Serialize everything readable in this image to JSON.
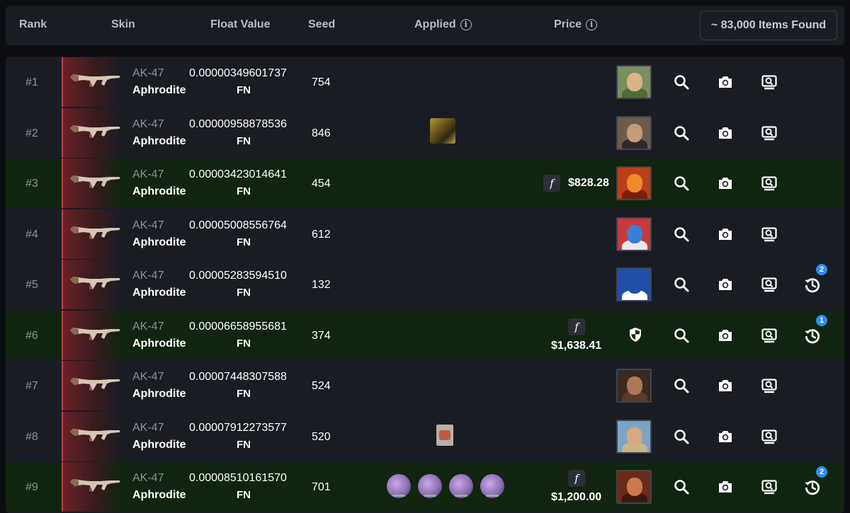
{
  "header": {
    "rank": "Rank",
    "skin": "Skin",
    "float_value": "Float Value",
    "seed": "Seed",
    "applied": "Applied",
    "price": "Price",
    "info_glyph": "i",
    "items_found": "~ 83,000 Items Found"
  },
  "rows": [
    {
      "rank": "#1",
      "weapon": "AK-47",
      "skin": "Aphrodite",
      "float": "0.00000349601737",
      "wear": "FN",
      "seed": "754",
      "price": "",
      "history": ""
    },
    {
      "rank": "#2",
      "weapon": "AK-47",
      "skin": "Aphrodite",
      "float": "0.00000958878536",
      "wear": "FN",
      "seed": "846",
      "price": "",
      "history": ""
    },
    {
      "rank": "#3",
      "weapon": "AK-47",
      "skin": "Aphrodite",
      "float": "0.00003423014641",
      "wear": "FN",
      "seed": "454",
      "price": "$828.28",
      "history": ""
    },
    {
      "rank": "#4",
      "weapon": "AK-47",
      "skin": "Aphrodite",
      "float": "0.00005008556764",
      "wear": "FN",
      "seed": "612",
      "price": "",
      "history": ""
    },
    {
      "rank": "#5",
      "weapon": "AK-47",
      "skin": "Aphrodite",
      "float": "0.00005283594510",
      "wear": "FN",
      "seed": "132",
      "price": "",
      "history": "2"
    },
    {
      "rank": "#6",
      "weapon": "AK-47",
      "skin": "Aphrodite",
      "float": "0.00006658955681",
      "wear": "FN",
      "seed": "374",
      "price": "$1,638.41",
      "history": "1"
    },
    {
      "rank": "#7",
      "weapon": "AK-47",
      "skin": "Aphrodite",
      "float": "0.00007448307588",
      "wear": "FN",
      "seed": "524",
      "price": "",
      "history": ""
    },
    {
      "rank": "#8",
      "weapon": "AK-47",
      "skin": "Aphrodite",
      "float": "0.00007912273577",
      "wear": "FN",
      "seed": "520",
      "price": "",
      "history": ""
    },
    {
      "rank": "#9",
      "weapon": "AK-47",
      "skin": "Aphrodite",
      "float": "0.00008510161570",
      "wear": "FN",
      "seed": "701",
      "price": "$1,200.00",
      "history": "2"
    }
  ],
  "float_badge_glyph": "f",
  "icons": {
    "inspect": "search-icon",
    "screenshot": "camera-icon",
    "view": "screen-search-icon",
    "history": "history-icon",
    "trade_protected": "shield-icon"
  },
  "colors": {
    "highlight_row": "#11240f",
    "row": "#1a1c23",
    "badge": "#2f8cff",
    "skin_accent": "#c2414b"
  }
}
